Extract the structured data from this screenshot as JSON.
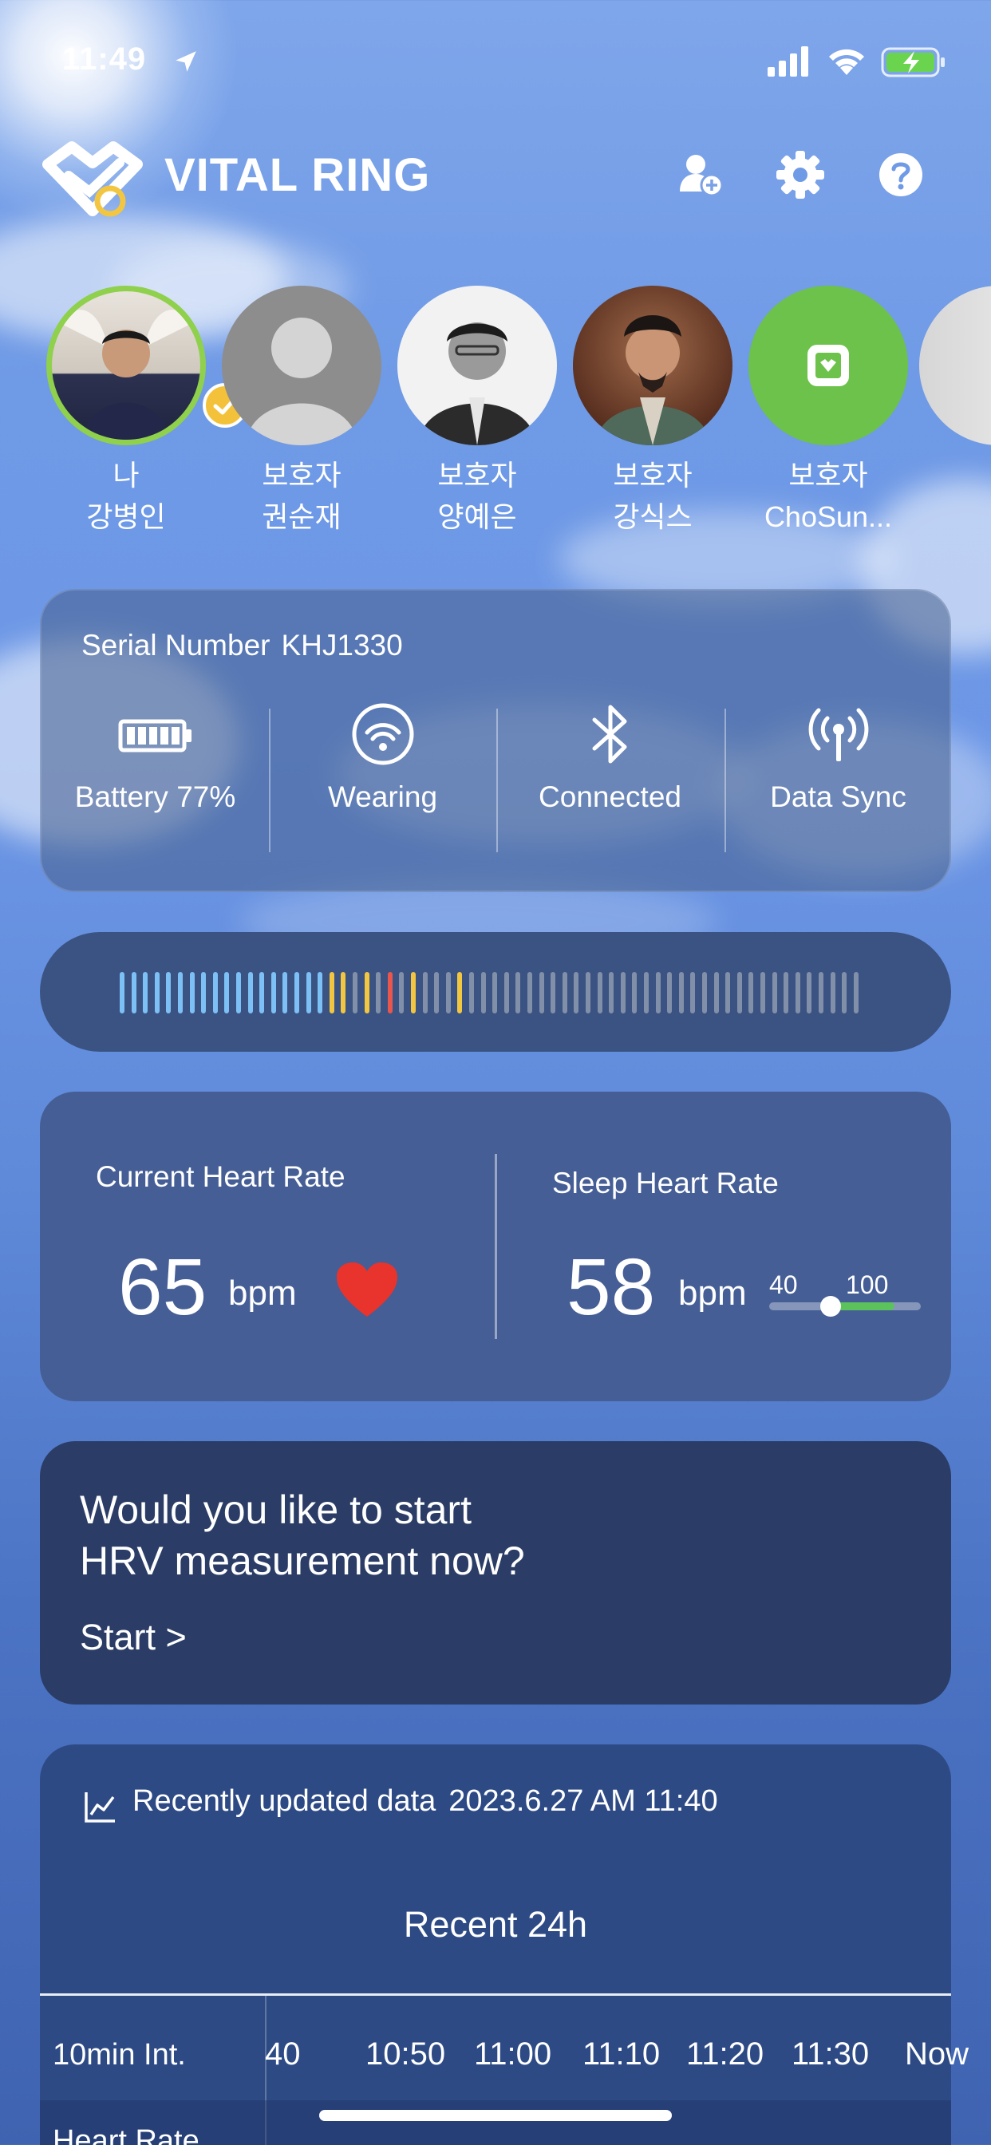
{
  "status_bar": {
    "time": "11:49"
  },
  "header": {
    "brand": "VITAL RING"
  },
  "profiles": [
    {
      "line1": "나",
      "line2": "강병인",
      "selected": true,
      "avatar": "photo-selfie"
    },
    {
      "line1": "보호자",
      "line2": "권순재",
      "selected": false,
      "avatar": "default-person-icon"
    },
    {
      "line1": "보호자",
      "line2": "양예은",
      "selected": false,
      "avatar": "photo-portrait-bw"
    },
    {
      "line1": "보호자",
      "line2": "강식스",
      "selected": false,
      "avatar": "photo-warrior"
    },
    {
      "line1": "보호자",
      "line2": "ChoSun...",
      "selected": false,
      "avatar": "app-logo-icon"
    }
  ],
  "device": {
    "serial_label": "Serial Number",
    "serial_value": "KHJ1330",
    "statuses": [
      {
        "label": "Battery 77%",
        "icon": "battery-icon"
      },
      {
        "label": "Wearing",
        "icon": "ring-wearing-icon"
      },
      {
        "label": "Connected",
        "icon": "bluetooth-icon"
      },
      {
        "label": "Data Sync",
        "icon": "broadcast-icon"
      }
    ]
  },
  "gauge": {
    "colors": {
      "blue": "#7cc0f5",
      "yellow": "#f2c640",
      "red": "#e8564e",
      "gray": "#8190a8"
    },
    "segments": [
      "blue",
      "blue",
      "blue",
      "blue",
      "blue",
      "blue",
      "blue",
      "blue",
      "blue",
      "blue",
      "blue",
      "blue",
      "blue",
      "blue",
      "blue",
      "blue",
      "blue",
      "blue",
      "yellow",
      "yellow",
      "gray",
      "yellow",
      "gray",
      "red",
      "gray",
      "yellow",
      "gray",
      "gray",
      "gray",
      "yellow",
      "gray",
      "gray",
      "gray",
      "gray",
      "gray",
      "gray",
      "gray",
      "gray",
      "gray",
      "gray",
      "gray",
      "gray",
      "gray",
      "gray",
      "gray",
      "gray",
      "gray",
      "gray",
      "gray",
      "gray",
      "gray",
      "gray",
      "gray",
      "gray",
      "gray",
      "gray",
      "gray",
      "gray",
      "gray",
      "gray",
      "gray",
      "gray",
      "gray",
      "gray"
    ]
  },
  "heart_rate": {
    "current_title": "Current Heart Rate",
    "current_value": "65",
    "current_unit": "bpm",
    "sleep_title": "Sleep Heart Rate",
    "sleep_value": "58",
    "sleep_unit": "bpm",
    "range_min_label": "40",
    "range_max_label": "100",
    "range_min": 40,
    "range_max": 100,
    "sleep_hr": 58,
    "heart_color": "#e8342c",
    "range_color": "#5cc25c"
  },
  "hrv": {
    "line1": "Would you like to start",
    "line2": "HRV measurement now?",
    "start_label": "Start >"
  },
  "recent": {
    "header_label": "Recently updated data",
    "timestamp": "2023.6.27 AM 11:40",
    "title": "Recent 24h",
    "interval_label": "10min Int.",
    "times": [
      "40",
      "10:50",
      "11:00",
      "11:10",
      "11:20",
      "11:30",
      "Now"
    ],
    "row2_label": "Heart Rate"
  }
}
